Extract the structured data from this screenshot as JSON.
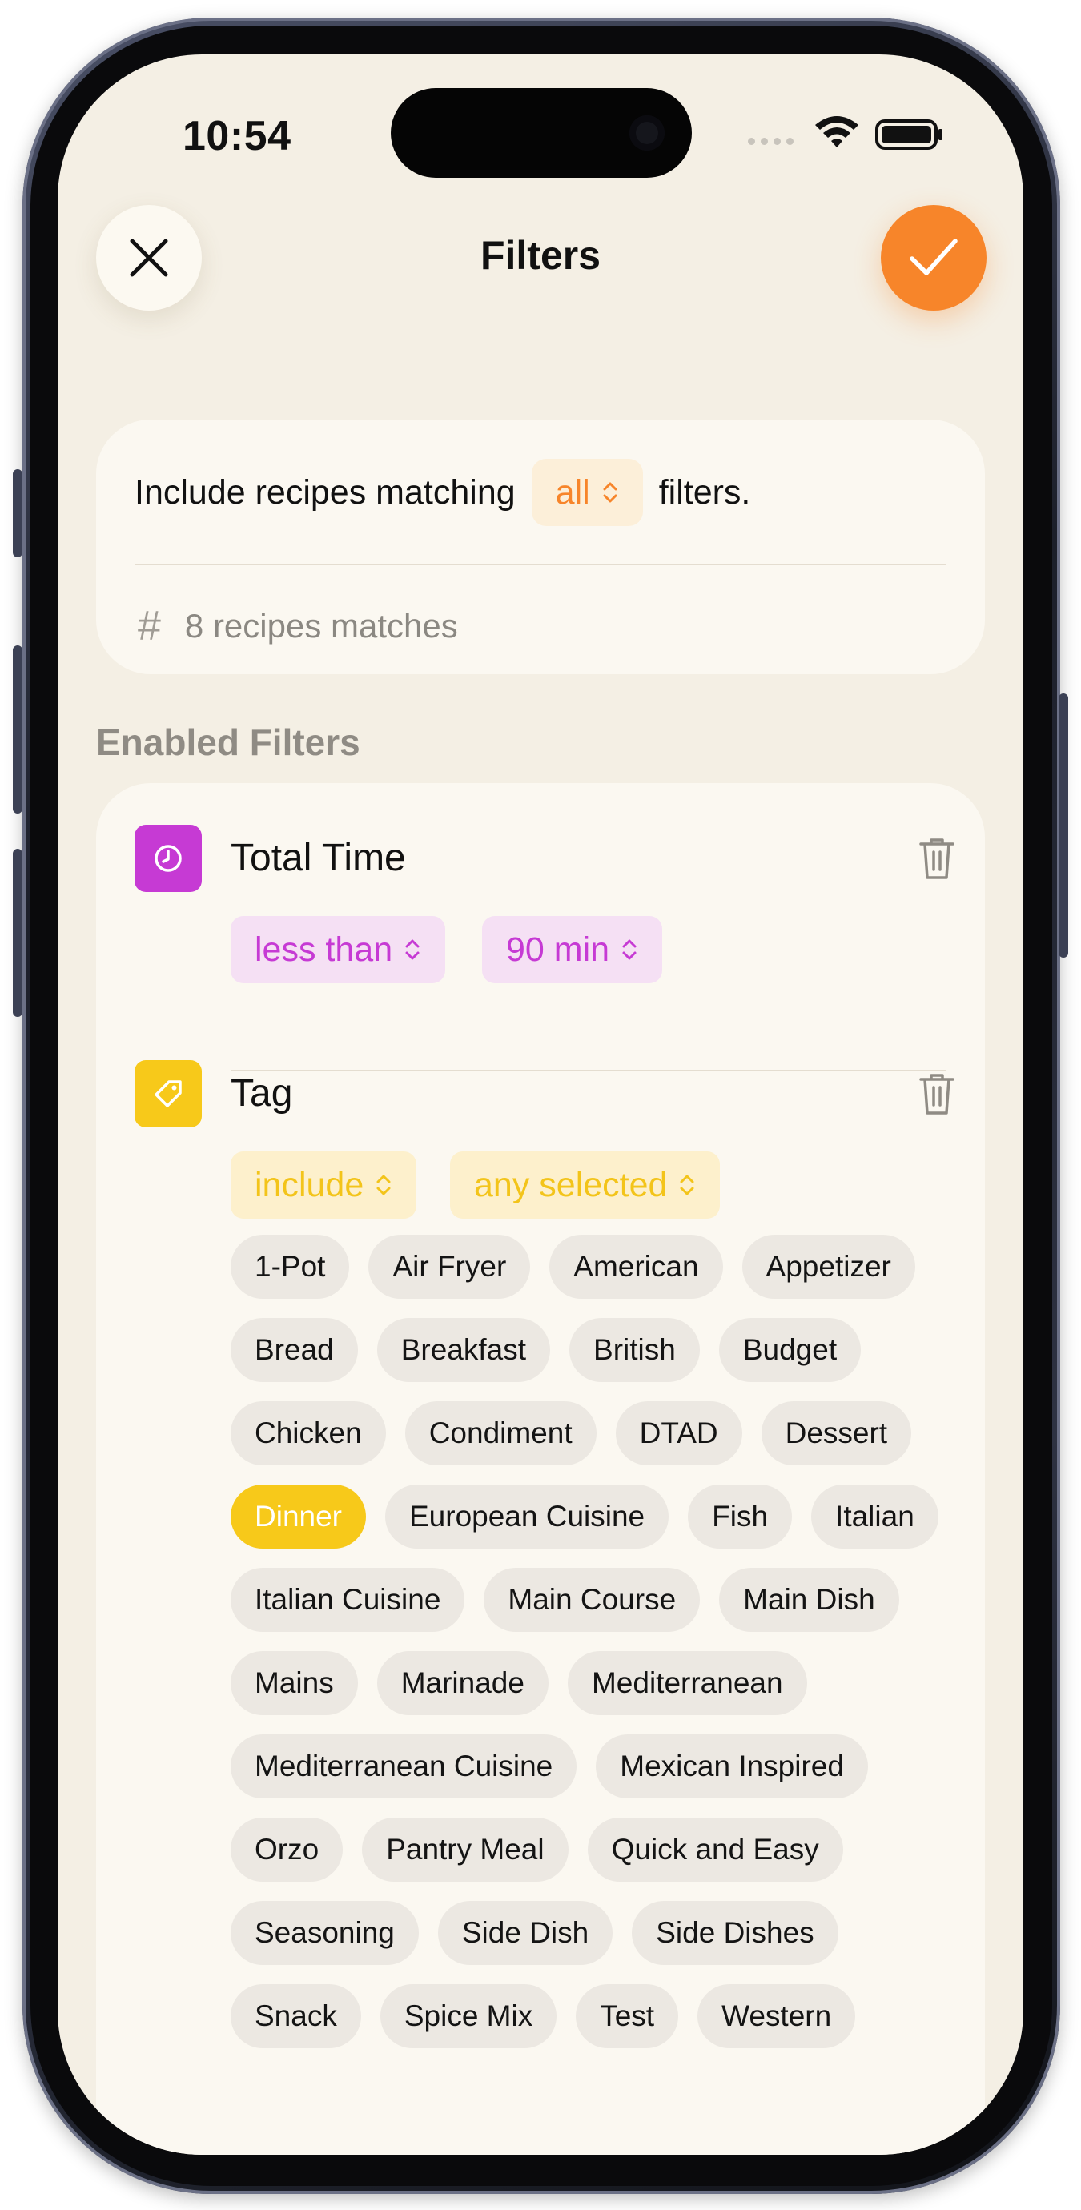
{
  "status_bar": {
    "time": "10:54"
  },
  "header": {
    "title": "Filters"
  },
  "summary": {
    "prefix": "Include recipes matching",
    "mode": "all",
    "suffix": "filters.",
    "count_text": "8 recipes matches"
  },
  "section_title": "Enabled Filters",
  "filters": [
    {
      "name": "Total Time",
      "icon": "clock-icon",
      "color": "#c63ad4",
      "operator": "less than",
      "value": "90 min"
    },
    {
      "name": "Tag",
      "icon": "tag-icon",
      "color": "#f7c91a",
      "operator": "include",
      "value": "any selected",
      "tags": [
        {
          "label": "1-Pot",
          "selected": false
        },
        {
          "label": "Air Fryer",
          "selected": false
        },
        {
          "label": "American",
          "selected": false
        },
        {
          "label": "Appetizer",
          "selected": false
        },
        {
          "label": "Bread",
          "selected": false
        },
        {
          "label": "Breakfast",
          "selected": false
        },
        {
          "label": "British",
          "selected": false
        },
        {
          "label": "Budget",
          "selected": false
        },
        {
          "label": "Chicken",
          "selected": false
        },
        {
          "label": "Condiment",
          "selected": false
        },
        {
          "label": "DTAD",
          "selected": false
        },
        {
          "label": "Dessert",
          "selected": false
        },
        {
          "label": "Dinner",
          "selected": true
        },
        {
          "label": "European Cuisine",
          "selected": false
        },
        {
          "label": "Fish",
          "selected": false
        },
        {
          "label": "Italian",
          "selected": false
        },
        {
          "label": "Italian Cuisine",
          "selected": false
        },
        {
          "label": "Main Course",
          "selected": false
        },
        {
          "label": "Main Dish",
          "selected": false
        },
        {
          "label": "Mains",
          "selected": false
        },
        {
          "label": "Marinade",
          "selected": false
        },
        {
          "label": "Mediterranean",
          "selected": false
        },
        {
          "label": "Mediterranean Cuisine",
          "selected": false
        },
        {
          "label": "Mexican Inspired",
          "selected": false
        },
        {
          "label": "Orzo",
          "selected": false
        },
        {
          "label": "Pantry Meal",
          "selected": false
        },
        {
          "label": "Quick and Easy",
          "selected": false
        },
        {
          "label": "Seasoning",
          "selected": false
        },
        {
          "label": "Side Dish",
          "selected": false
        },
        {
          "label": "Side Dishes",
          "selected": false
        },
        {
          "label": "Snack",
          "selected": false
        },
        {
          "label": "Spice Mix",
          "selected": false
        },
        {
          "label": "Test",
          "selected": false
        },
        {
          "label": "Western",
          "selected": false
        }
      ]
    }
  ],
  "colors": {
    "accent": "#f7852a",
    "background": "#f4efe4",
    "card": "#fbf8f1"
  }
}
